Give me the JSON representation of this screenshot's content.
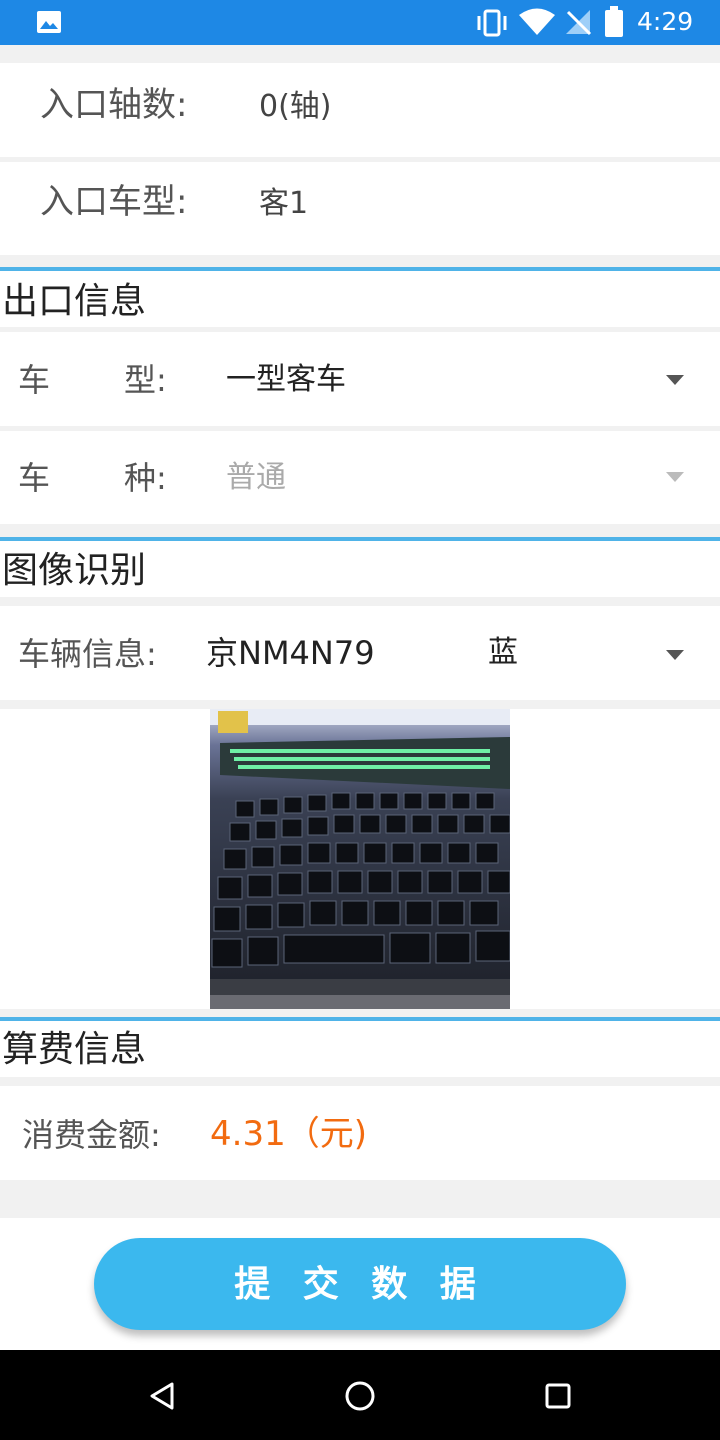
{
  "status_bar": {
    "time": "4:29",
    "icons": [
      "gallery-icon",
      "vibrate-icon",
      "wifi-icon",
      "no-signal-icon",
      "battery-icon"
    ]
  },
  "entry": {
    "axles_label": "入口轴数:",
    "axles_value": "0(轴)",
    "vehicle_type_label": "入口车型:",
    "vehicle_type_value": "客1"
  },
  "exit_info": {
    "title": "出口信息",
    "type_label_a": "车",
    "type_label_b": "型:",
    "type_value": "一型客车",
    "kind_label_a": "车",
    "kind_label_b": "种:",
    "kind_value": "普通"
  },
  "image_recognition": {
    "title": "图像识别",
    "vehicle_label": "车辆信息:",
    "plate": "京NM4N79",
    "plate_color": "蓝"
  },
  "fee_info": {
    "title": "算费信息",
    "amount_label": "消费金额:",
    "amount_value": "4.31（元)"
  },
  "submit_label": "提 交 数 据",
  "colors": {
    "status_bar": "#1e88e5",
    "accent_line": "#4fb3e8",
    "button": "#3bb8ee",
    "amount": "#f26b10",
    "section_gap": "#f1f1f1"
  }
}
